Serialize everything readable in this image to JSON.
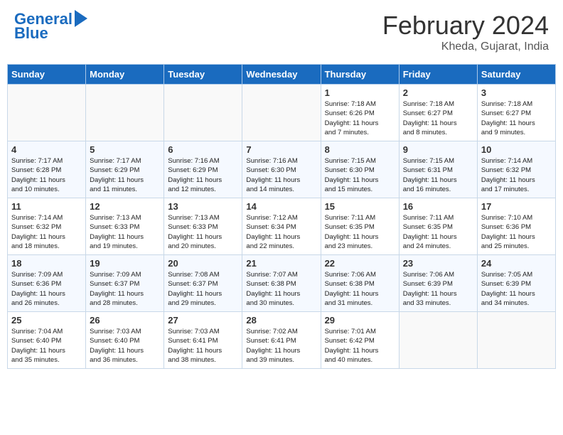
{
  "header": {
    "logo_line1": "General",
    "logo_line2": "Blue",
    "month_year": "February 2024",
    "location": "Kheda, Gujarat, India"
  },
  "days_of_week": [
    "Sunday",
    "Monday",
    "Tuesday",
    "Wednesday",
    "Thursday",
    "Friday",
    "Saturday"
  ],
  "weeks": [
    [
      {
        "day": "",
        "info": ""
      },
      {
        "day": "",
        "info": ""
      },
      {
        "day": "",
        "info": ""
      },
      {
        "day": "",
        "info": ""
      },
      {
        "day": "1",
        "info": "Sunrise: 7:18 AM\nSunset: 6:26 PM\nDaylight: 11 hours\nand 7 minutes."
      },
      {
        "day": "2",
        "info": "Sunrise: 7:18 AM\nSunset: 6:27 PM\nDaylight: 11 hours\nand 8 minutes."
      },
      {
        "day": "3",
        "info": "Sunrise: 7:18 AM\nSunset: 6:27 PM\nDaylight: 11 hours\nand 9 minutes."
      }
    ],
    [
      {
        "day": "4",
        "info": "Sunrise: 7:17 AM\nSunset: 6:28 PM\nDaylight: 11 hours\nand 10 minutes."
      },
      {
        "day": "5",
        "info": "Sunrise: 7:17 AM\nSunset: 6:29 PM\nDaylight: 11 hours\nand 11 minutes."
      },
      {
        "day": "6",
        "info": "Sunrise: 7:16 AM\nSunset: 6:29 PM\nDaylight: 11 hours\nand 12 minutes."
      },
      {
        "day": "7",
        "info": "Sunrise: 7:16 AM\nSunset: 6:30 PM\nDaylight: 11 hours\nand 14 minutes."
      },
      {
        "day": "8",
        "info": "Sunrise: 7:15 AM\nSunset: 6:30 PM\nDaylight: 11 hours\nand 15 minutes."
      },
      {
        "day": "9",
        "info": "Sunrise: 7:15 AM\nSunset: 6:31 PM\nDaylight: 11 hours\nand 16 minutes."
      },
      {
        "day": "10",
        "info": "Sunrise: 7:14 AM\nSunset: 6:32 PM\nDaylight: 11 hours\nand 17 minutes."
      }
    ],
    [
      {
        "day": "11",
        "info": "Sunrise: 7:14 AM\nSunset: 6:32 PM\nDaylight: 11 hours\nand 18 minutes."
      },
      {
        "day": "12",
        "info": "Sunrise: 7:13 AM\nSunset: 6:33 PM\nDaylight: 11 hours\nand 19 minutes."
      },
      {
        "day": "13",
        "info": "Sunrise: 7:13 AM\nSunset: 6:33 PM\nDaylight: 11 hours\nand 20 minutes."
      },
      {
        "day": "14",
        "info": "Sunrise: 7:12 AM\nSunset: 6:34 PM\nDaylight: 11 hours\nand 22 minutes."
      },
      {
        "day": "15",
        "info": "Sunrise: 7:11 AM\nSunset: 6:35 PM\nDaylight: 11 hours\nand 23 minutes."
      },
      {
        "day": "16",
        "info": "Sunrise: 7:11 AM\nSunset: 6:35 PM\nDaylight: 11 hours\nand 24 minutes."
      },
      {
        "day": "17",
        "info": "Sunrise: 7:10 AM\nSunset: 6:36 PM\nDaylight: 11 hours\nand 25 minutes."
      }
    ],
    [
      {
        "day": "18",
        "info": "Sunrise: 7:09 AM\nSunset: 6:36 PM\nDaylight: 11 hours\nand 26 minutes."
      },
      {
        "day": "19",
        "info": "Sunrise: 7:09 AM\nSunset: 6:37 PM\nDaylight: 11 hours\nand 28 minutes."
      },
      {
        "day": "20",
        "info": "Sunrise: 7:08 AM\nSunset: 6:37 PM\nDaylight: 11 hours\nand 29 minutes."
      },
      {
        "day": "21",
        "info": "Sunrise: 7:07 AM\nSunset: 6:38 PM\nDaylight: 11 hours\nand 30 minutes."
      },
      {
        "day": "22",
        "info": "Sunrise: 7:06 AM\nSunset: 6:38 PM\nDaylight: 11 hours\nand 31 minutes."
      },
      {
        "day": "23",
        "info": "Sunrise: 7:06 AM\nSunset: 6:39 PM\nDaylight: 11 hours\nand 33 minutes."
      },
      {
        "day": "24",
        "info": "Sunrise: 7:05 AM\nSunset: 6:39 PM\nDaylight: 11 hours\nand 34 minutes."
      }
    ],
    [
      {
        "day": "25",
        "info": "Sunrise: 7:04 AM\nSunset: 6:40 PM\nDaylight: 11 hours\nand 35 minutes."
      },
      {
        "day": "26",
        "info": "Sunrise: 7:03 AM\nSunset: 6:40 PM\nDaylight: 11 hours\nand 36 minutes."
      },
      {
        "day": "27",
        "info": "Sunrise: 7:03 AM\nSunset: 6:41 PM\nDaylight: 11 hours\nand 38 minutes."
      },
      {
        "day": "28",
        "info": "Sunrise: 7:02 AM\nSunset: 6:41 PM\nDaylight: 11 hours\nand 39 minutes."
      },
      {
        "day": "29",
        "info": "Sunrise: 7:01 AM\nSunset: 6:42 PM\nDaylight: 11 hours\nand 40 minutes."
      },
      {
        "day": "",
        "info": ""
      },
      {
        "day": "",
        "info": ""
      }
    ]
  ]
}
